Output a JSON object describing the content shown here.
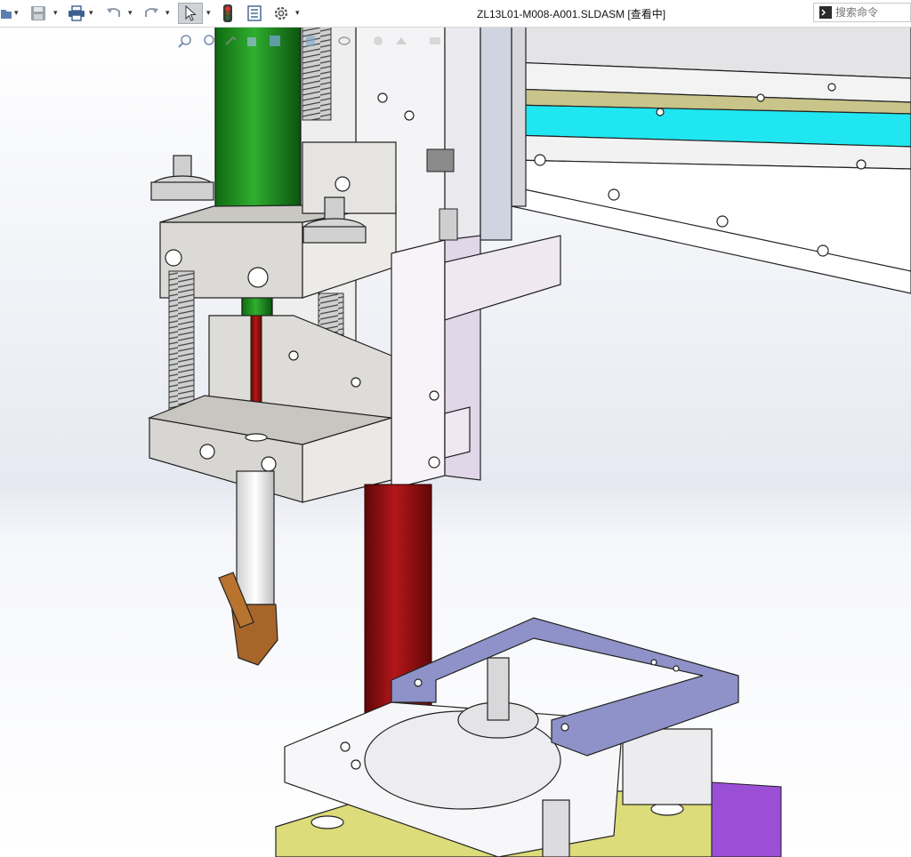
{
  "window": {
    "title": "ZL13L01-M008-A001.SLDASM [查看中]"
  },
  "toolbar": {
    "buttons": [
      {
        "name": "open-icon"
      },
      {
        "name": "save-icon"
      },
      {
        "name": "print-icon"
      },
      {
        "name": "undo-icon"
      },
      {
        "name": "redo-icon"
      },
      {
        "name": "select-pointer-icon"
      },
      {
        "name": "rebuild-traffic-light-icon"
      },
      {
        "name": "file-properties-icon"
      },
      {
        "name": "options-gear-icon"
      }
    ]
  },
  "search": {
    "placeholder": "搜索命令"
  },
  "heads_up_toolbar": {
    "icons": [
      "zoom-to-fit-icon",
      "zoom-area-icon",
      "previous-view-icon",
      "section-view-icon",
      "view-orientation-icon",
      "display-style-icon",
      "hide-show-items-icon",
      "edit-appearance-icon",
      "apply-scene-icon",
      "view-settings-icon"
    ]
  },
  "colors": {
    "rail_cyan": "#1fe6f0",
    "rail_olive": "#c8c48a",
    "nozzle_green": "#1e8c1e",
    "rod_red": "#8e0f0f",
    "plate_lavender": "#8e92c8",
    "base_yellow": "#dcdc7a",
    "base_purple": "#9a4fd6",
    "copper_tip": "#a8652a"
  }
}
